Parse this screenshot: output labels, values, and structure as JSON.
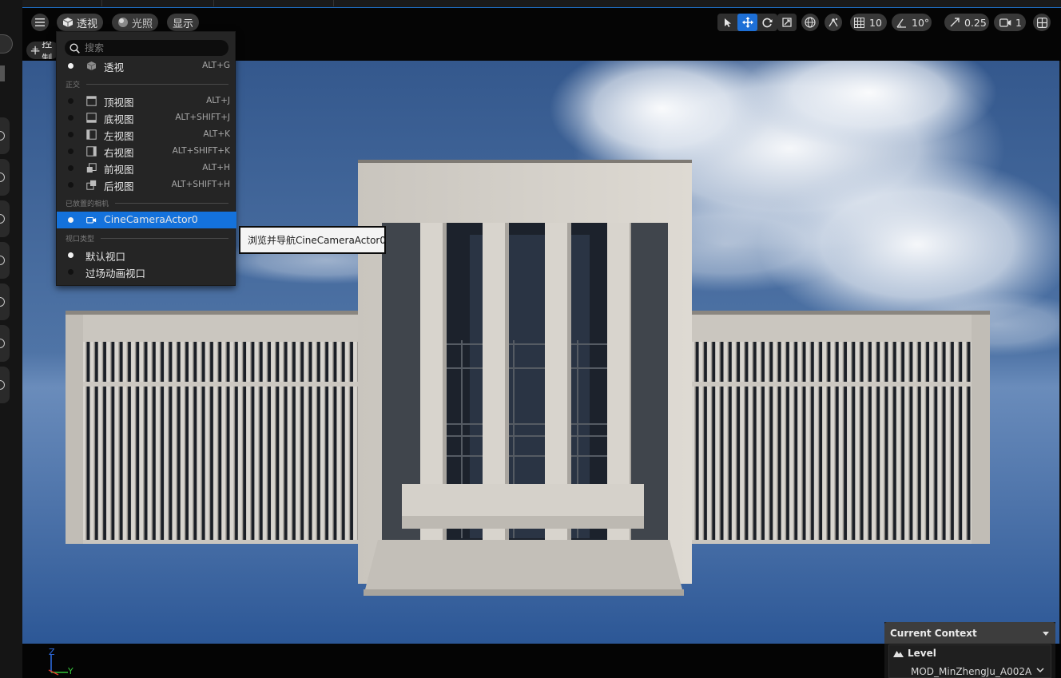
{
  "toolbar": {
    "view_mode_label": "透视",
    "lighting_label": "光照",
    "show_label": "显示",
    "control_chip_label": "控制",
    "grid_snap_value": "10",
    "rotation_snap_value": "10°",
    "scale_snap_value": "0.25",
    "camera_speed_value": "1"
  },
  "view_menu": {
    "search_placeholder": "搜索",
    "perspective": {
      "label": "透视",
      "shortcut": "ALT+G"
    },
    "ortho_section": "正交",
    "ortho_items": [
      {
        "label": "顶视图",
        "shortcut": "ALT+J"
      },
      {
        "label": "底视图",
        "shortcut": "ALT+SHIFT+J"
      },
      {
        "label": "左视图",
        "shortcut": "ALT+K"
      },
      {
        "label": "右视图",
        "shortcut": "ALT+SHIFT+K"
      },
      {
        "label": "前视图",
        "shortcut": "ALT+H"
      },
      {
        "label": "后视图",
        "shortcut": "ALT+SHIFT+H"
      }
    ],
    "cameras_section": "已放置的相机",
    "camera_item": {
      "label": "CineCameraActor0"
    },
    "viewport_type_section": "视口类型",
    "viewport_types": [
      {
        "label": "默认视口"
      },
      {
        "label": "过场动画视口"
      }
    ]
  },
  "tooltip": {
    "text": "浏览并导航CineCameraActor0"
  },
  "axis": {
    "z": "Z",
    "y": "Y"
  },
  "context_panel": {
    "header": "Current Context",
    "level_label": "Level",
    "level_value": "MOD_MinZhengJu_A002A"
  },
  "colors": {
    "accent": "#1472dc",
    "sky_top": "#2f548a",
    "sky_bottom": "#2b5694",
    "building": "#cfcbc4"
  }
}
